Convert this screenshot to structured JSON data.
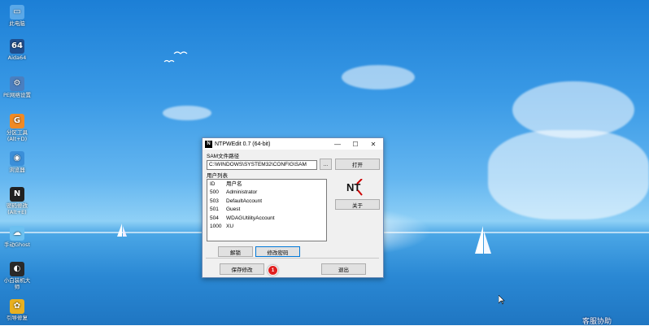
{
  "desktop": {
    "icons": [
      {
        "label": "此电脑",
        "icon": "computer-icon",
        "glyph": "▭",
        "color": "#5aa8e8"
      },
      {
        "label": "Aida64",
        "icon": "aida64-icon",
        "glyph": "64",
        "color": "#1f4f8f"
      },
      {
        "label": "PE网络设置",
        "icon": "network-icon",
        "glyph": "⚙",
        "color": "#4a7fc0"
      },
      {
        "label": "分区工具\n(Alt+D)",
        "icon": "partition-tool-icon",
        "glyph": "G",
        "color": "#f08a24"
      },
      {
        "label": "浏览器",
        "icon": "browser-icon",
        "glyph": "◉",
        "color": "#3b8fd9"
      },
      {
        "label": "密码修改\n(Alt+E)",
        "icon": "password-tool-icon",
        "glyph": "N",
        "color": "#222222"
      },
      {
        "label": "手动Ghost",
        "icon": "ghost-icon",
        "glyph": "☁",
        "color": "#6cc0f0"
      },
      {
        "label": "小白装机大\n师",
        "icon": "installer-icon",
        "glyph": "◐",
        "color": "#2a2a2a"
      },
      {
        "label": "引导修复",
        "icon": "boot-repair-icon",
        "glyph": "✿",
        "color": "#e8b020"
      }
    ],
    "helper_text": "客服协助"
  },
  "window": {
    "title": "NTPWEdit 0.7 (64-bit)",
    "sam_label": "SAM文件路径",
    "sam_path": "C:\\WINDOWS\\SYSTEM32\\CONFIG\\SAM",
    "browse_label": "...",
    "open_label": "打开",
    "users_label": "用户列表",
    "columns": {
      "id": "ID",
      "name": "用户名"
    },
    "users": [
      {
        "id": "500",
        "name": "Administrator"
      },
      {
        "id": "503",
        "name": "DefaultAccount"
      },
      {
        "id": "501",
        "name": "Guest"
      },
      {
        "id": "504",
        "name": "WDAGUtilityAccount"
      },
      {
        "id": "1000",
        "name": "XU"
      }
    ],
    "about_label": "关于",
    "unlock_label": "解锁",
    "change_pw_label": "修改密码",
    "save_label": "保存修改",
    "exit_label": "退出",
    "badge": "1",
    "logo_text": "NT"
  },
  "colors": {
    "accent": "#0078d7",
    "badge": "#e02020"
  }
}
